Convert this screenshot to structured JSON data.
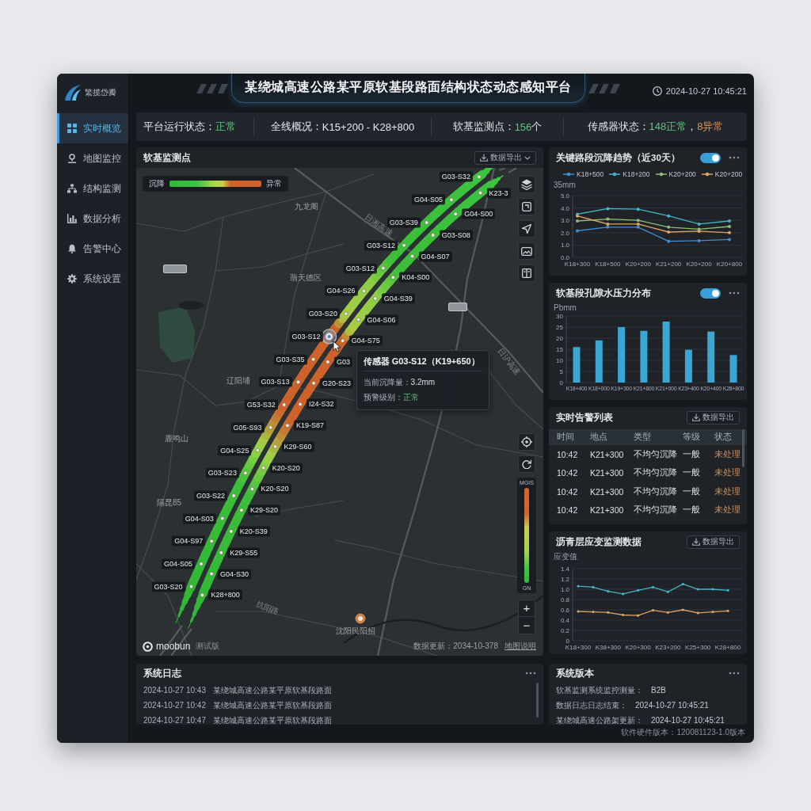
{
  "window": {
    "logo": "繁揽岱瓣",
    "title": "某绕城高速公路某平原软基段路面结构状态动态感知平台",
    "datetime": "2024-10-27 10:45:21"
  },
  "sidebar": {
    "items": [
      {
        "label": "实时概览",
        "selected": true
      },
      {
        "label": "地图监控",
        "selected": false
      },
      {
        "label": "结构监测",
        "selected": false
      },
      {
        "label": "数据分析",
        "selected": false
      },
      {
        "label": "告警中心",
        "selected": false
      },
      {
        "label": "系统设置",
        "selected": false
      }
    ]
  },
  "status_bar": {
    "items": [
      {
        "label": "平台运行状态：",
        "parts": [
          {
            "text": "正常",
            "kind": "ok"
          }
        ]
      },
      {
        "label": "全线概况：",
        "parts": [
          {
            "text": "K15+200 - K28+800",
            "kind": "plain"
          }
        ]
      },
      {
        "label": "软基监测点：",
        "parts": [
          {
            "text": "156",
            "kind": "ok"
          },
          {
            "text": "个",
            "kind": "plain"
          }
        ]
      },
      {
        "label": "传感器状态：",
        "parts": [
          {
            "text": "148正常",
            "kind": "ok"
          },
          {
            "text": "，",
            "kind": "plain"
          },
          {
            "text": "8异常",
            "kind": "warn"
          }
        ]
      }
    ]
  },
  "map_panel": {
    "title": "软基监测点",
    "export_button": "数据导出",
    "legend": {
      "low": "沉降",
      "high": "异常"
    },
    "places": [
      "九龙阁",
      "翡天德区",
      "辽阳埔",
      "鹿鸣山",
      "隔昆85"
    ],
    "poi": "沈阳民阳招",
    "road_names": [
      "日湘高速",
      "日沪高速",
      "抗阳路"
    ],
    "carriageways": [
      {
        "sensors": [
          {
            "label": "G03-S32",
            "selected": false
          },
          {
            "label": "G04-S05",
            "selected": false
          },
          {
            "label": "G03-S39",
            "selected": false
          },
          {
            "label": "G03-S12",
            "selected": false
          },
          {
            "label": "G03-S12",
            "selected": false
          },
          {
            "label": "G04-S26",
            "selected": false
          },
          {
            "label": "G03-S20",
            "selected": false
          },
          {
            "label": "G03-S12",
            "selected": true
          },
          {
            "label": "G03-S35",
            "selected": false
          },
          {
            "label": "G03-S13",
            "selected": false
          },
          {
            "label": "G53-S32",
            "selected": false
          },
          {
            "label": "G05-S93",
            "selected": false
          },
          {
            "label": "G04-S25",
            "selected": false
          },
          {
            "label": "G03-S23",
            "selected": false
          },
          {
            "label": "G03-S22",
            "selected": false
          },
          {
            "label": "G04-S03",
            "selected": false
          },
          {
            "label": "G04-S97",
            "selected": false
          },
          {
            "label": "G04-S05",
            "selected": false
          },
          {
            "label": "G03-S20",
            "selected": false
          }
        ]
      },
      {
        "sensors": [
          {
            "label": "K23-3",
            "selected": false
          },
          {
            "label": "G04-S00",
            "selected": false
          },
          {
            "label": "G03-S08",
            "selected": false
          },
          {
            "label": "G04-S07",
            "selected": false
          },
          {
            "label": "K04-S00",
            "selected": false
          },
          {
            "label": "G04-S39",
            "selected": false
          },
          {
            "label": "G04-S06",
            "selected": false
          },
          {
            "label": "G04-S75",
            "selected": false
          },
          {
            "label": "G03",
            "selected": false
          },
          {
            "label": "G20-S23",
            "selected": false
          },
          {
            "label": "I24-S32",
            "selected": false
          },
          {
            "label": "K19-S87",
            "selected": false
          },
          {
            "label": "K29-S60",
            "selected": false
          },
          {
            "label": "K20-S20",
            "selected": false
          },
          {
            "label": "K20-S20",
            "selected": false
          },
          {
            "label": "K29-S20",
            "selected": false
          },
          {
            "label": "K20-S39",
            "selected": false
          },
          {
            "label": "K29-S55",
            "selected": false
          },
          {
            "label": "G04-S30",
            "selected": false
          },
          {
            "label": "K28+800",
            "selected": false
          }
        ]
      }
    ],
    "tooltip": {
      "title": "传感器 G03-S12（K19+650）",
      "rows": [
        {
          "label": "当前沉降量：",
          "value": "3.2mm",
          "kind": "plain"
        },
        {
          "label": "预警级别：",
          "value": "正常",
          "kind": "ok"
        }
      ]
    },
    "scale": {
      "top": "MGIS",
      "bottom": "GN"
    },
    "zoom": [
      "+",
      "−"
    ],
    "brand": "moobun",
    "brand_note": "测试版",
    "update": "数据更新：2034-10-378",
    "map_note": "地图说明"
  },
  "trend_panel": {
    "title": "关键路段沉降趋势（近30天）",
    "toggle": {
      "on": true
    },
    "chart_data": {
      "type": "line",
      "ylabel": "35mm",
      "grid": true,
      "categories": [
        "K18+300",
        "K18+500",
        "K20+200",
        "K21+200",
        "K20+200",
        "K20+800"
      ],
      "series": [
        {
          "name": "K18+500",
          "color": "#3f8fd2",
          "values": [
            2.15,
            2.45,
            2.45,
            1.3,
            1.35,
            1.45
          ]
        },
        {
          "name": "K18+200",
          "color": "#45b4c8",
          "values": [
            3.5,
            3.95,
            3.9,
            3.35,
            2.7,
            2.95
          ]
        },
        {
          "name": "K20+200",
          "color": "#8cbf78",
          "values": [
            2.95,
            3.1,
            3.0,
            2.45,
            2.28,
            2.5
          ]
        },
        {
          "name": "K20+200",
          "color": "#dda466",
          "values": [
            3.35,
            2.7,
            2.7,
            2.05,
            2.12,
            2.0
          ]
        }
      ],
      "ylim": [
        0,
        5
      ],
      "yticks": [
        {
          "value": 0,
          "label": "0.0"
        },
        {
          "value": 1,
          "label": "1.0"
        },
        {
          "value": 2,
          "label": "2.0"
        },
        {
          "value": 3,
          "label": "3.0"
        },
        {
          "value": 4,
          "label": "4.0"
        },
        {
          "value": 5,
          "label": "5.0"
        }
      ]
    }
  },
  "pressure_panel": {
    "title": "软基段孔隙水压力分布",
    "toggle": {
      "on": true
    },
    "chart_data": {
      "type": "bar",
      "ylabel": "Pbmm",
      "grid": true,
      "categories": [
        "K18+400",
        "K18+000",
        "K19+300",
        "K21+800",
        "K21+000",
        "K23+400",
        "K20+400",
        "K28+800"
      ],
      "values": [
        16,
        19,
        25,
        23.3,
        27.5,
        14.8,
        23,
        12.4
      ],
      "ylim": [
        0,
        30
      ],
      "yticks": [
        0,
        5,
        10,
        15,
        20,
        25,
        30
      ]
    }
  },
  "alarm_panel": {
    "title": "实时告警列表",
    "export_button": "数据导出",
    "columns": [
      "时间",
      "地点",
      "类型",
      "等级",
      "状态"
    ],
    "rows": [
      [
        "10:42",
        "K21+300",
        "不均匀沉降",
        "一般",
        "未处理"
      ],
      [
        "10:42",
        "K21+300",
        "不均匀沉降",
        "一般",
        "未处理"
      ],
      [
        "10:42",
        "K21+300",
        "不均匀沉降",
        "一般",
        "未处理"
      ],
      [
        "10:42",
        "K21+300",
        "不均匀沉降",
        "一般",
        "未处理"
      ]
    ]
  },
  "strain_panel": {
    "title": "沥青层应变监测数据",
    "export_button": "数据导出",
    "chart_data": {
      "type": "line",
      "ylabel": "应变值",
      "grid": true,
      "categories": [
        "K18+300",
        null,
        "K38+300",
        null,
        "K20+300",
        null,
        "K23+200",
        null,
        "K25+300",
        null,
        "K28+800"
      ],
      "series": [
        {
          "color": "#46b4c8",
          "values": [
            1.06,
            1.04,
            0.96,
            0.91,
            0.98,
            1.04,
            0.95,
            1.1,
            1.0,
            1.0,
            0.98
          ]
        },
        {
          "color": "#d9a466",
          "values": [
            0.57,
            0.56,
            0.55,
            0.5,
            0.49,
            0.59,
            0.55,
            0.6,
            0.54,
            0.56,
            0.58
          ]
        }
      ],
      "ylim": [
        0,
        1.4
      ],
      "yticks": [
        0,
        {
          "value": 0.2,
          "label": "0.2"
        },
        {
          "value": 0.4,
          "label": "0.4"
        },
        {
          "value": 0.6,
          "label": "0.6"
        },
        {
          "value": 0.8,
          "label": "0.8"
        },
        {
          "value": 1,
          "label": "1.0"
        },
        {
          "value": 1.2,
          "label": "1.2"
        },
        {
          "value": 1.4,
          "label": "1.4"
        }
      ]
    }
  },
  "log_panel": {
    "title": "系统日志",
    "entries": [
      {
        "time": "2024-10-27 10:43",
        "text": "某绕城高速公路某平原软基段路面"
      },
      {
        "time": "2024-10-27 10:42",
        "text": "某绕城高速公路某平原软基段路面"
      },
      {
        "time": "2024-10-27 10:47",
        "text": "某绕城高速公路某平原软基段路面"
      }
    ]
  },
  "version_panel": {
    "title": "系统版本",
    "rows": [
      {
        "label": "软基监测系统监控测量：",
        "value": "B2B"
      },
      {
        "label": "数据日志日志结束：",
        "value": "2024-10-27 10:45:21"
      },
      {
        "label": "某绕城高速公路架更新：",
        "value": "2024-10-27 10:45:21"
      }
    ]
  },
  "footer": "软件硬件版本：120081123-1.0版本"
}
